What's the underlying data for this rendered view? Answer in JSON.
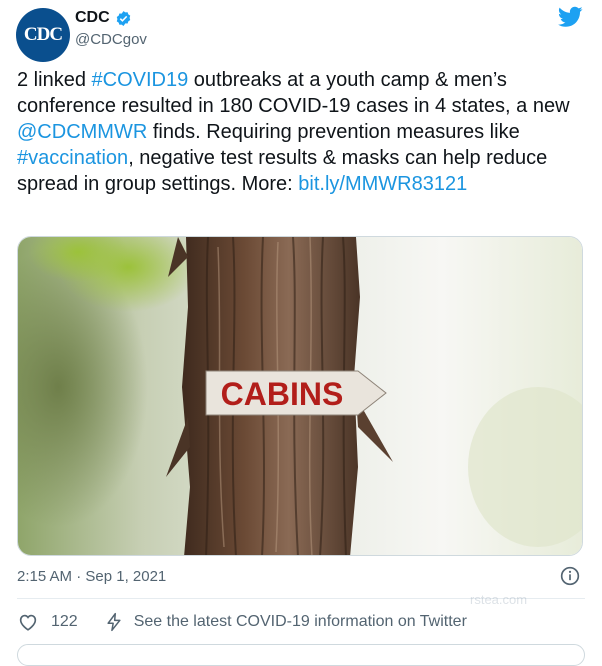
{
  "author": {
    "avatar_text": "CDC",
    "name": "CDC",
    "handle": "@CDCgov"
  },
  "tweet": {
    "parts": [
      "2 linked ",
      "#COVID19",
      " outbreaks at a youth camp & men’s conference resulted in 180 COVID-19 cases in 4 states, a new ",
      "@CDCMMWR",
      " finds. Requiring prevention measures like ",
      "#vaccination",
      ", negative test results & masks can help reduce spread in group settings. More: ",
      "bit.ly/MMWR83121"
    ]
  },
  "media": {
    "sign_text": "CABINS"
  },
  "meta": {
    "timestamp": "2:15 AM · Sep 1, 2021"
  },
  "actions": {
    "like_count": "122",
    "covid_info": "See the latest COVID-19 information on Twitter"
  },
  "watermark": "rstea.com",
  "colors": {
    "link": "#1b95e0",
    "twitter_blue": "#1da1f2",
    "avatar_bg": "#0a4f8e"
  }
}
